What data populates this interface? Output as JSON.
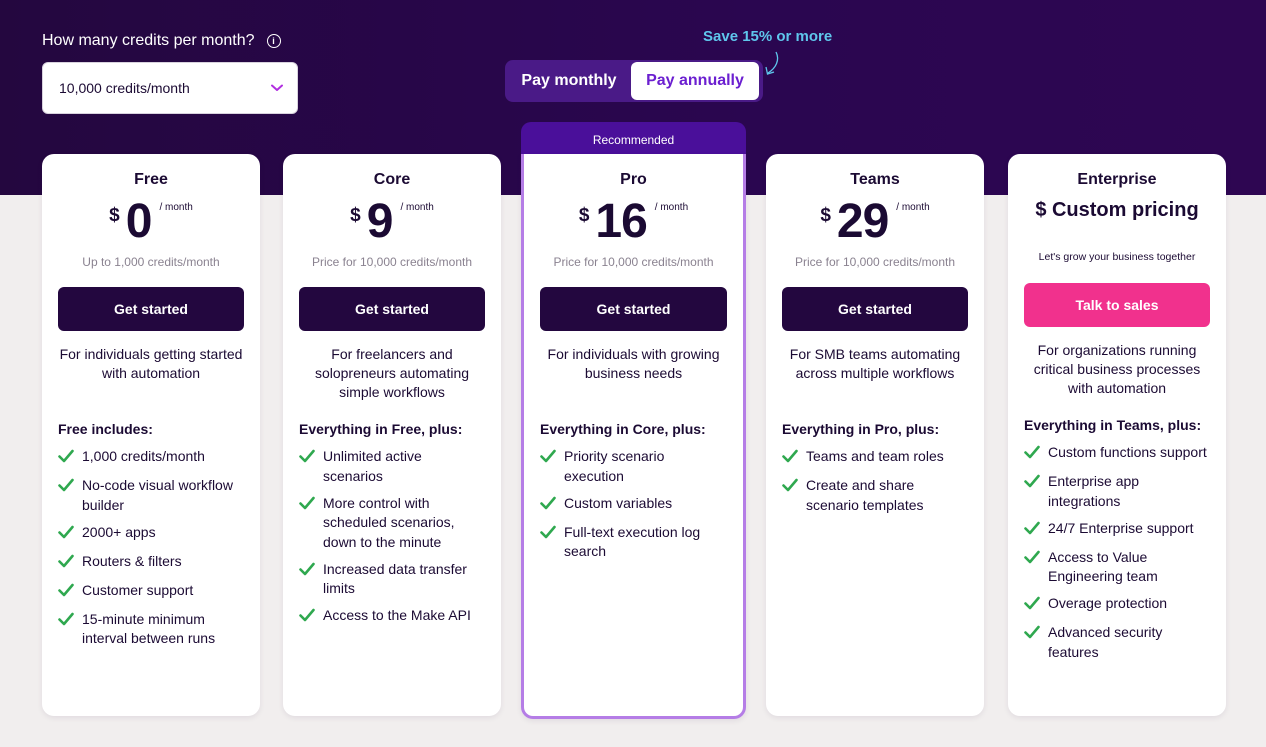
{
  "credits": {
    "label": "How many credits per month?",
    "info_icon": "info-icon",
    "selected": "10,000 credits/month"
  },
  "billing": {
    "save_note": "Save 15% or more",
    "monthly_label": "Pay monthly",
    "annually_label": "Pay annually",
    "active": "annually"
  },
  "recommended_label": "Recommended",
  "colors": {
    "hero_bg": "#24073f",
    "cta_dark": "#23073f",
    "cta_sales": "#f1318d",
    "check": "#2fa84f",
    "pro_border": "#b57de6"
  },
  "plans": [
    {
      "name": "Free",
      "currency": "$",
      "amount": "0",
      "unit": "/ month",
      "note": "Up to 1,000 credits/month",
      "cta": "Get started",
      "description": "For individuals getting started with automation",
      "includes_title": "Free includes:",
      "features": [
        "1,000 credits/month",
        "No-code visual workflow builder",
        "2000+ apps",
        "Routers & filters",
        "Customer support",
        "15-minute minimum interval between runs"
      ]
    },
    {
      "name": "Core",
      "currency": "$",
      "amount": "9",
      "unit": "/ month",
      "note": "Price for 10,000 credits/month",
      "cta": "Get started",
      "description": "For freelancers and solopreneurs automating simple workflows",
      "includes_title": "Everything in Free, plus:",
      "features": [
        "Unlimited active scenarios",
        "More control with scheduled scenarios, down to the minute",
        "Increased data transfer limits",
        "Access to the Make API"
      ]
    },
    {
      "name": "Pro",
      "currency": "$",
      "amount": "16",
      "unit": "/ month",
      "note": "Price for 10,000 credits/month",
      "cta": "Get started",
      "description": "For individuals with growing business needs",
      "includes_title": "Everything in Core, plus:",
      "features": [
        "Priority scenario execution",
        "Custom variables",
        "Full-text execution log search"
      ]
    },
    {
      "name": "Teams",
      "currency": "$",
      "amount": "29",
      "unit": "/ month",
      "note": "Price for 10,000 credits/month",
      "cta": "Get started",
      "description": "For SMB teams automating across multiple workflows",
      "includes_title": "Everything in Pro, plus:",
      "features": [
        "Teams and team roles",
        "Create and share scenario templates"
      ]
    },
    {
      "name": "Enterprise",
      "custom_price": "$ Custom pricing",
      "note": "Let's grow your business together",
      "cta": "Talk to sales",
      "description": "For organizations running critical business processes with automation",
      "includes_title": "Everything in Teams, plus:",
      "features": [
        "Custom functions support",
        "Enterprise app integrations",
        "24/7 Enterprise support",
        "Access to Value Engineering team",
        "Overage protection",
        "Advanced security features"
      ]
    }
  ]
}
